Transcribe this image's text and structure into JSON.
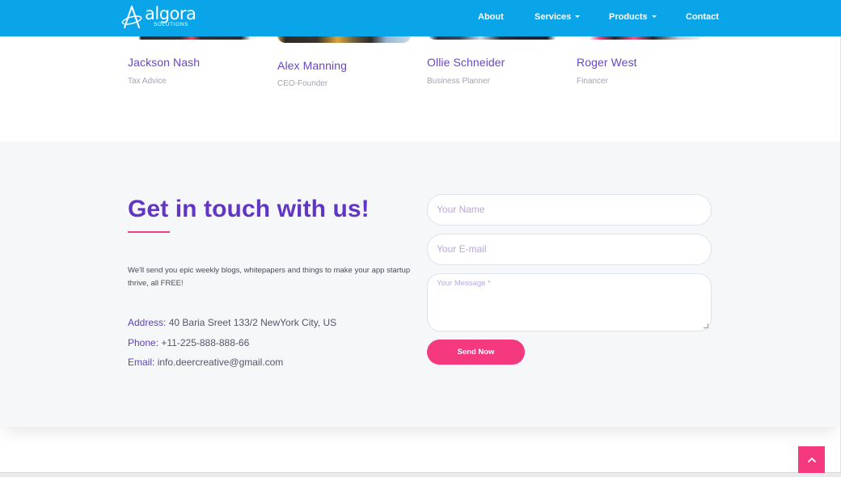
{
  "nav": {
    "logo_text": "algora",
    "logo_sub": "SOLUTIONS",
    "items": [
      {
        "label": "About"
      },
      {
        "label": "Services"
      },
      {
        "label": "Products"
      },
      {
        "label": "Contact"
      }
    ]
  },
  "team": [
    {
      "name": "Jackson Nash",
      "role": "Tax Advice"
    },
    {
      "name": "Alex Manning",
      "role": "CEO-Founder"
    },
    {
      "name": "Ollie Schneider",
      "role": "Business Planner"
    },
    {
      "name": "Roger West",
      "role": "Financer"
    }
  ],
  "contact": {
    "heading": "Get in touch with us!",
    "intro": "We'll send you epic weekly blogs, whitepapers and things to make your app startup thrive, all FREE!",
    "address_label": "Address:",
    "address_value": "40 Baria Sreet 133/2 NewYork City, US",
    "phone_label": "Phone:",
    "phone_value": "+11-225-888-888-66",
    "email_label": "Email:",
    "email_value": "info.deercreative@gmail.com"
  },
  "form": {
    "name_placeholder": "Your Name",
    "email_placeholder": "Your E-mail",
    "message_placeholder": "Your Message *",
    "submit_label": "Send Now"
  },
  "colors": {
    "nav_bg": "#0aa4e8",
    "accent_purple": "#6236c5",
    "accent_pink": "#f5397f",
    "section_bg": "#f6f7f9"
  }
}
